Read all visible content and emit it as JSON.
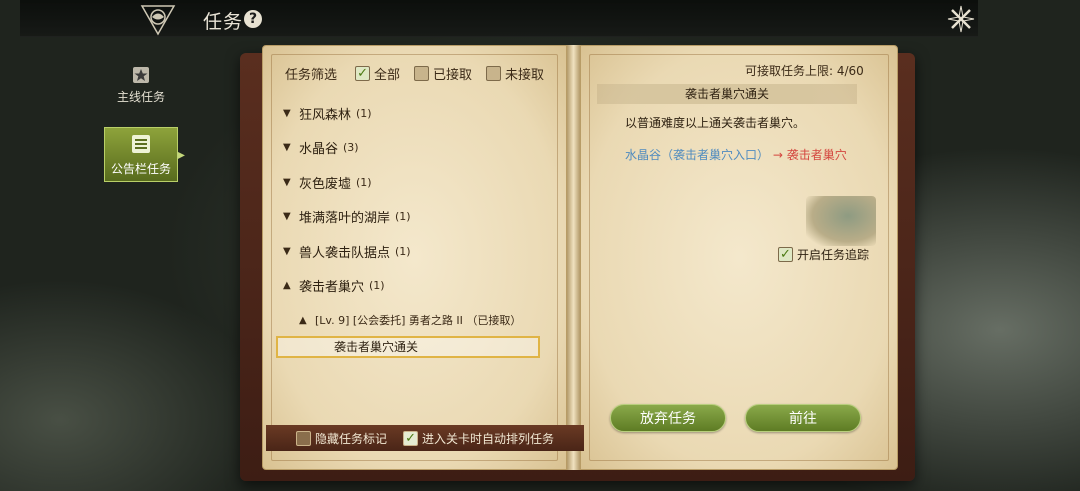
{
  "header": {
    "title": "任务",
    "help_label": "?"
  },
  "side_tabs": [
    {
      "label": "主线任务",
      "icon": "scroll-star-icon",
      "active": false
    },
    {
      "label": "公告栏任务",
      "icon": "bulletin-board-icon",
      "active": true
    }
  ],
  "filter": {
    "label": "任务筛选",
    "options": [
      {
        "label": "全部",
        "checked": true
      },
      {
        "label": "已接取",
        "checked": false
      },
      {
        "label": "未接取",
        "checked": false
      }
    ]
  },
  "quest_groups": [
    {
      "name": "狂风森林",
      "count": "(1)",
      "expanded": false
    },
    {
      "name": "水晶谷",
      "count": "(3)",
      "expanded": false
    },
    {
      "name": "灰色废墟",
      "count": "(1)",
      "expanded": false
    },
    {
      "name": "堆满落叶的湖岸",
      "count": "(1)",
      "expanded": false
    },
    {
      "name": "兽人袭击队据点",
      "count": "(1)",
      "expanded": false
    },
    {
      "name": "袭击者巢穴",
      "count": "(1)",
      "expanded": true
    }
  ],
  "sub_quest": "[Lv. 9] [公会委托] 勇者之路 II （已接取）",
  "selected_quest": "袭击者巢穴通关",
  "bottom_options": [
    {
      "label": "隐藏任务标记",
      "checked": false
    },
    {
      "label": "进入关卡时自动排列任务",
      "checked": true
    }
  ],
  "detail": {
    "limit_text": "可接取任务上限: 4/60",
    "title": "袭击者巢穴通关",
    "description": "以普通难度以上通关袭击者巢穴。",
    "route_from": "水晶谷（袭击者巢穴入口）",
    "route_to": "→ 袭击者巢穴",
    "track_label": "开启任务追踪",
    "track_checked": true,
    "abandon_label": "放弃任务",
    "go_label": "前往"
  },
  "colors": {
    "accent_green": "#7a9a35",
    "selected_border": "#e0b445",
    "route_from": "#4f8bbf",
    "route_to": "#d4463f"
  }
}
